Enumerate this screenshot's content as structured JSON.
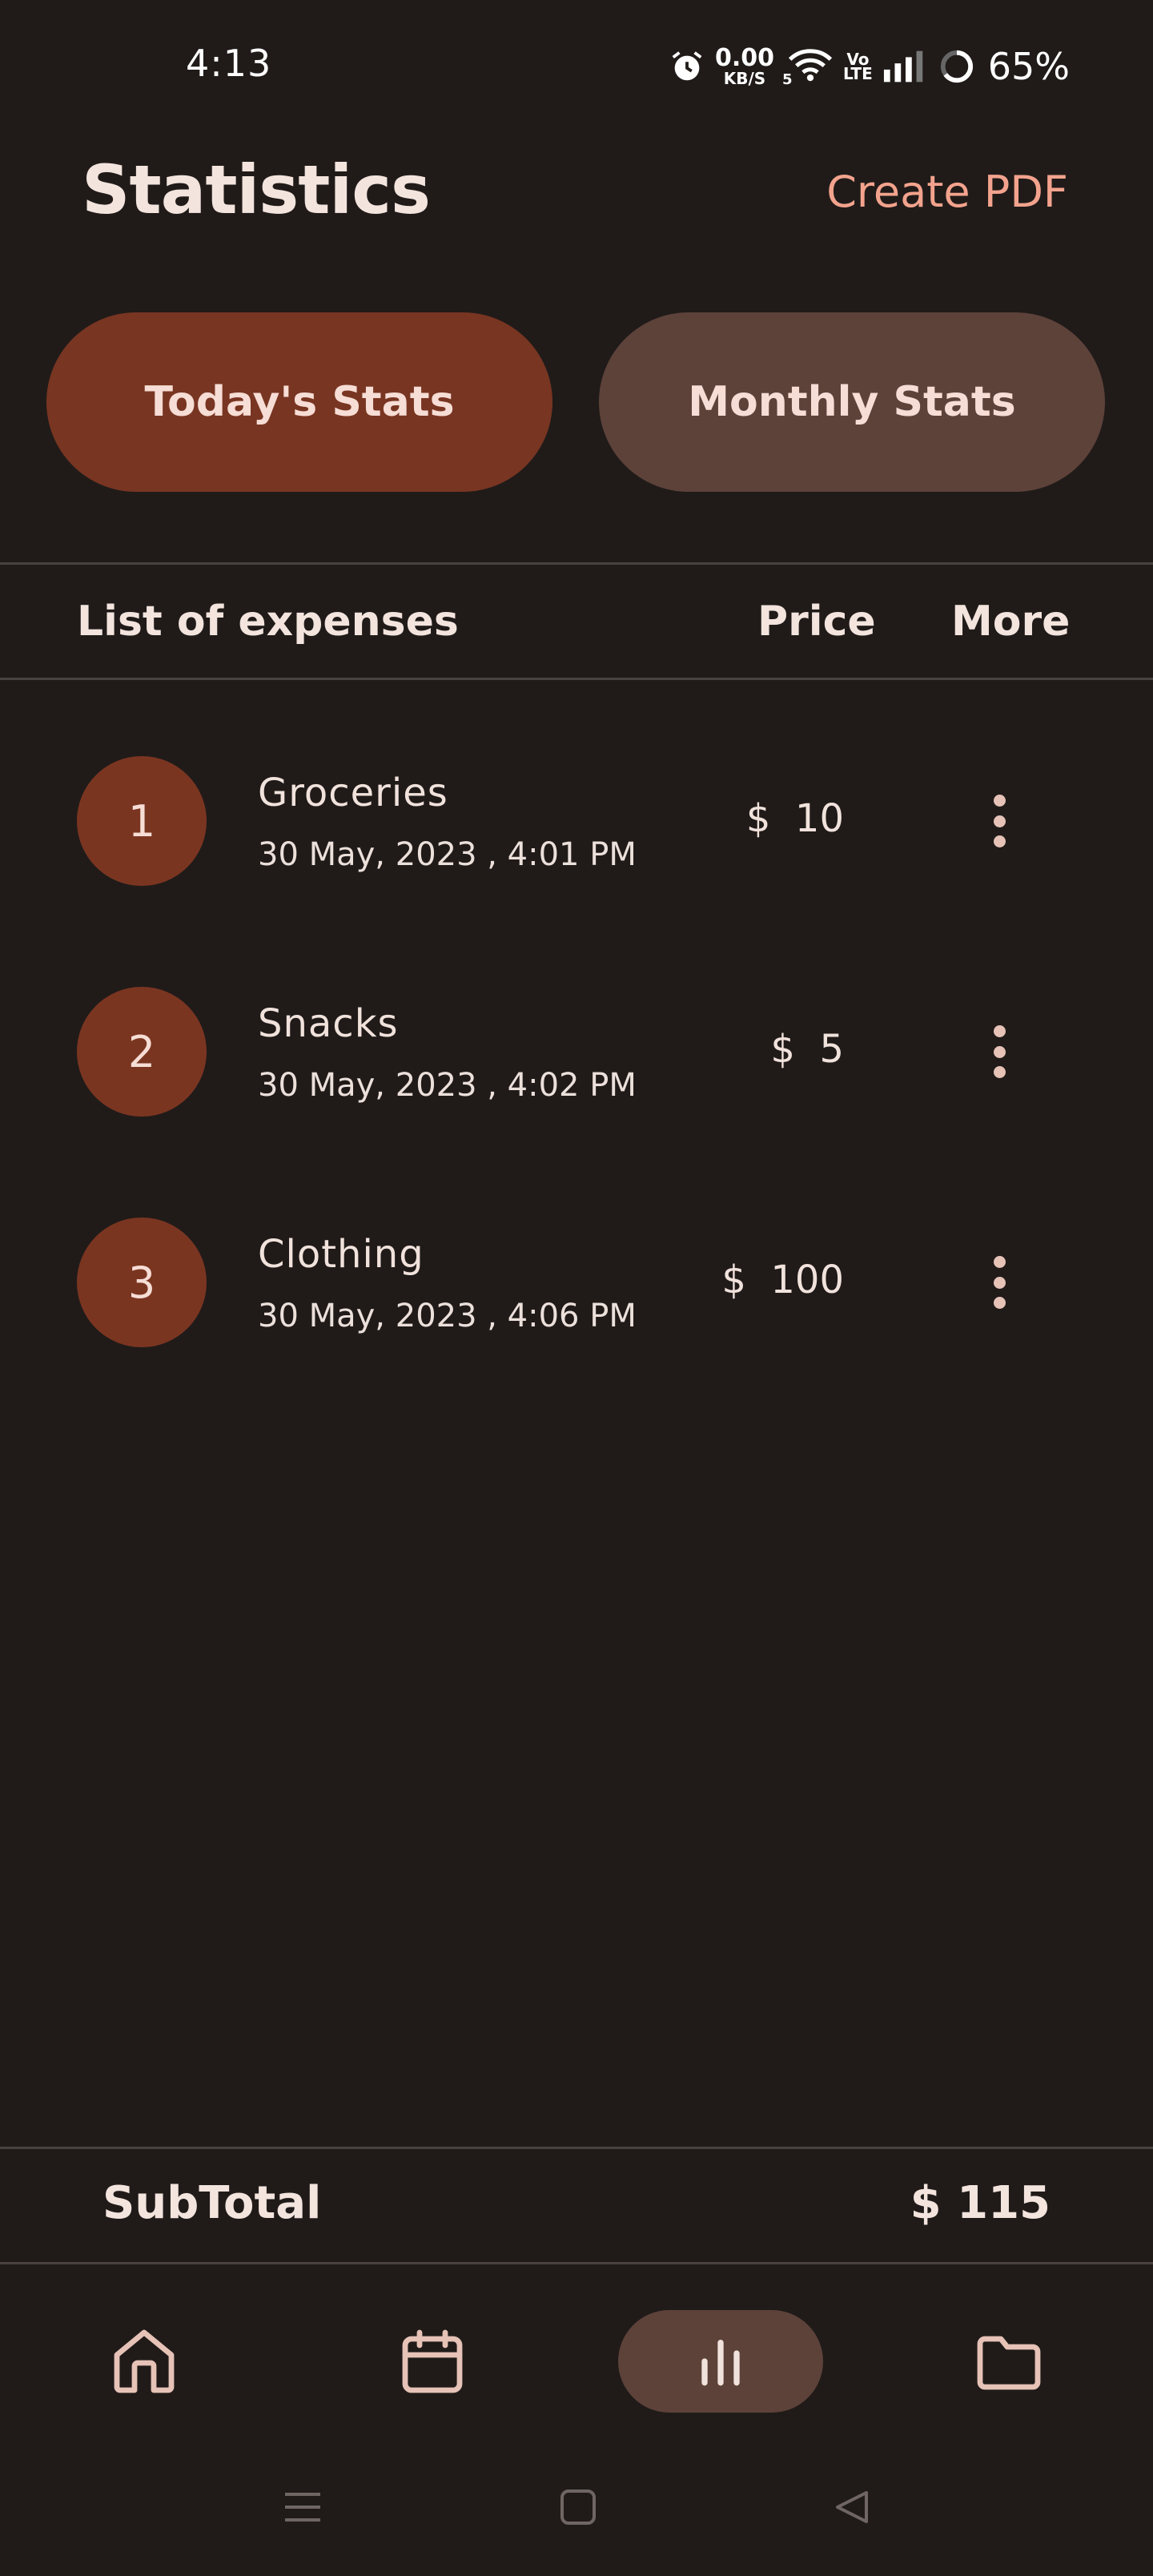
{
  "status_bar": {
    "time": "4:13",
    "net_speed_value": "0.00",
    "net_speed_unit": "KB/S",
    "wifi_sub": "5",
    "volte_top": "Vo",
    "volte_bottom": "LTE",
    "battery": "65%"
  },
  "header": {
    "title": "Statistics",
    "create_pdf": "Create PDF"
  },
  "tabs": {
    "today": "Today's Stats",
    "monthly": "Monthly Stats"
  },
  "list_header": {
    "expenses": "List of expenses",
    "price": "Price",
    "more": "More"
  },
  "expenses": [
    {
      "index": "1",
      "name": "Groceries",
      "date": "30 May, 2023 , 4:01 PM",
      "price": "$  10"
    },
    {
      "index": "2",
      "name": "Snacks",
      "date": "30 May, 2023 , 4:02 PM",
      "price": "$  5"
    },
    {
      "index": "3",
      "name": "Clothing",
      "date": "30 May, 2023 , 4:06 PM",
      "price": "$  100"
    }
  ],
  "subtotal": {
    "label": "SubTotal",
    "value": "$ 115"
  },
  "bottom_nav": {
    "items": [
      "home-icon",
      "calendar-icon",
      "bar-chart-icon",
      "folder-icon"
    ],
    "active": "bar-chart-icon"
  },
  "colors": {
    "background": "#201b19",
    "accent": "#783522",
    "secondary": "#5d423a",
    "link": "#f3a38d"
  }
}
